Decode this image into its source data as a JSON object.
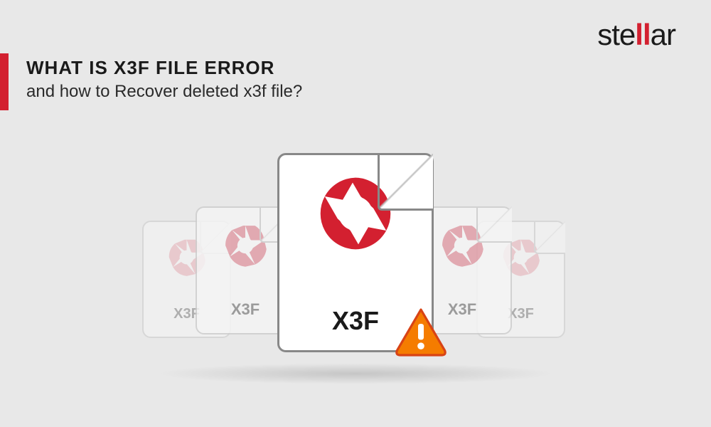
{
  "brand": {
    "name_part1": "ste",
    "name_part2": "ll",
    "name_part3": "ar"
  },
  "heading": {
    "main": "WHAT IS X3F FILE ERROR",
    "sub": "and how to Recover deleted x3f file?"
  },
  "files": {
    "main_label": "X3F",
    "bg_label": "X3F"
  },
  "colors": {
    "accent": "#d32030",
    "warning_fill": "#f57c00",
    "warning_stroke": "#d84315"
  }
}
